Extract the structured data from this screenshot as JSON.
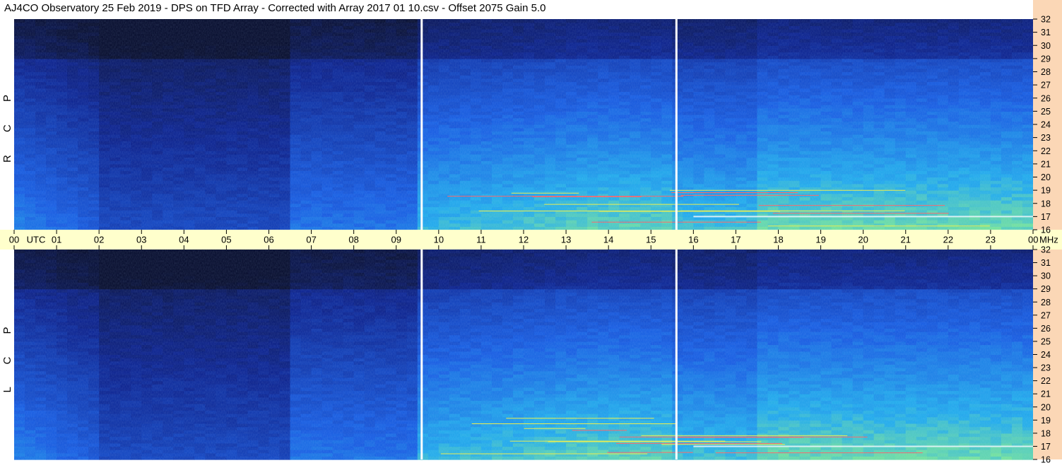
{
  "header": {
    "title": "AJ4CO Observatory  25 Feb 2019  -  DPS on TFD Array  -  Corrected with Array 2017 01 10.csv  -  Offset 2075  Gain 5.0"
  },
  "colors": {
    "time_axis_bg": "#ffffcc",
    "freq_axis_bg": "#fbd7b6",
    "low_intensity": "#05114a",
    "mid_intensity": "#1a6fe8",
    "high_intensity": "#b8f020",
    "peak_intensity": "#ff2a2a"
  },
  "chart_data": [
    {
      "type": "heatmap",
      "panel": "top",
      "channel_label": "R C P",
      "x_axis": {
        "unit_label": "UTC",
        "ticks": [
          "00",
          "01",
          "02",
          "03",
          "04",
          "05",
          "06",
          "07",
          "08",
          "09",
          "10",
          "11",
          "12",
          "13",
          "14",
          "15",
          "16",
          "17",
          "18",
          "19",
          "20",
          "21",
          "22",
          "23",
          "00"
        ],
        "range_hours": [
          0,
          24
        ]
      },
      "y_axis": {
        "unit_label": "MHz",
        "range": [
          16,
          32
        ],
        "ticks": [
          16,
          17,
          18,
          19,
          20,
          21,
          22,
          23,
          24,
          25,
          26,
          27,
          28,
          29,
          30,
          31,
          32
        ]
      },
      "data_gaps_utc_hours": [
        9.6,
        15.6
      ],
      "dark_region_utc_hours": [
        2,
        6.6
      ]
    },
    {
      "type": "heatmap",
      "panel": "bottom",
      "channel_label": "L C P",
      "x_axis": {
        "ticks": [
          "00",
          "01",
          "02",
          "03",
          "04",
          "05",
          "06",
          "07",
          "08",
          "09",
          "10",
          "11",
          "12",
          "13",
          "14",
          "15",
          "16",
          "17",
          "18",
          "19",
          "20",
          "21",
          "22",
          "23",
          "00"
        ],
        "range_hours": [
          0,
          24
        ]
      },
      "y_axis": {
        "range": [
          16,
          32
        ],
        "ticks": [
          16,
          17,
          18,
          19,
          20,
          21,
          22,
          23,
          24,
          25,
          26,
          27,
          28,
          29,
          30,
          31,
          32
        ]
      },
      "data_gaps_utc_hours": [
        9.6,
        15.6
      ],
      "dark_region_utc_hours": [
        2,
        6.6
      ]
    }
  ]
}
